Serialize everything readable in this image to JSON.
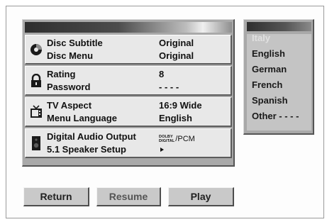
{
  "settings": {
    "disc_subtitle": {
      "label": "Disc Subtitle",
      "value": "Original"
    },
    "disc_menu": {
      "label": "Disc Menu",
      "value": "Original"
    },
    "rating": {
      "label": "Rating",
      "value": "8"
    },
    "password": {
      "label": "Password",
      "value": "- - - -"
    },
    "tv_aspect": {
      "label": "TV Aspect",
      "value": "16:9 Wide"
    },
    "menu_language": {
      "label": "Menu Language",
      "value": "English"
    },
    "digital_audio_output": {
      "label": "Digital Audio Output",
      "value_logo_line1": "DOLBY",
      "value_logo_line2": "DIGITAL",
      "value_suffix": "/PCM"
    },
    "speaker_setup": {
      "label": "5.1 Speaker Setup"
    }
  },
  "language_list": {
    "items": [
      "Italy",
      "English",
      "German",
      "French",
      "Spanish",
      "Other - - - -"
    ]
  },
  "buttons": {
    "return": "Return",
    "resume": "Resume",
    "play": "Play"
  },
  "icons": {
    "disc": "disc-icon",
    "lock": "lock-icon",
    "tv": "tv-icon",
    "speaker": "speaker-icon"
  }
}
